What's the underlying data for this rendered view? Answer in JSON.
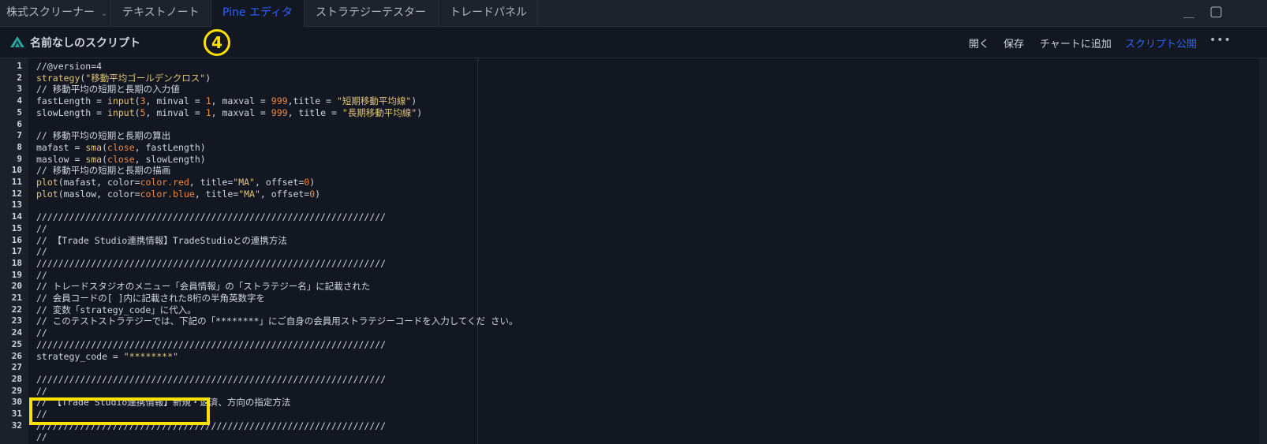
{
  "tabs": [
    {
      "label": "株式スクリーナー",
      "has_chevron": true
    },
    {
      "label": "テキストノート"
    },
    {
      "label": "Pine エディタ",
      "active": true
    },
    {
      "label": "ストラテジーテスター"
    },
    {
      "label": "トレードパネル"
    }
  ],
  "window": {
    "minimize": "＿",
    "maximize": "▢"
  },
  "toolbar": {
    "title": "名前なしのスクリプト",
    "badge": "4",
    "open": "開く",
    "save": "保存",
    "add_to_chart": "チャートに追加",
    "publish": "スクリプト公開",
    "more": "•••"
  },
  "colors": {
    "accent": "#2962ff",
    "highlight": "#ffe100",
    "background": "#131722"
  },
  "code_lines": [
    "//@version=4",
    "strategy(\"移動平均ゴールデンクロス\")",
    "// 移動平均の短期と長期の入力値",
    "fastLength = input(3, minval = 1, maxval = 999,title = \"短期移動平均線\")",
    "slowLength = input(5, minval = 1, maxval = 999, title = \"長期移動平均線\")",
    "",
    "// 移動平均の短期と長期の算出",
    "mafast = sma(close, fastLength)",
    "maslow = sma(close, slowLength)",
    "// 移動平均の短期と長期の描画",
    "plot(mafast, color=color.red, title=\"MA\", offset=0)",
    "plot(maslow, color=color.blue, title=\"MA\", offset=0)",
    "",
    "////////////////////////////////////////////////////////////////",
    "//",
    "// 【Trade Studio連携情報】TradeStudioとの連携方法",
    "//",
    "////////////////////////////////////////////////////////////////",
    "//",
    "// トレードスタジオのメニュー「会員情報」の「ストラテジー名」に記載された",
    "// 会員コードの[ ]内に記載された8桁の半角英数字を",
    "// 変数「strategy_code」に代入。",
    "// このテストストラテジーでは、下記の「********」にご自身の会員用ストラテジーコードを入力してくだ さい。",
    "//",
    "////////////////////////////////////////////////////////////////",
    "strategy_code = \"********\"",
    "",
    "////////////////////////////////////////////////////////////////",
    "//",
    "// 【Trade Studio連携情報】新規・返済、方向の指定方法",
    "//",
    "////////////////////////////////////////////////////////////////",
    "//"
  ],
  "line_numbers": [
    "1",
    "2",
    "3",
    "4",
    "5",
    "6",
    "7",
    "8",
    "9",
    "10",
    "11",
    "12",
    "13",
    "14",
    "15",
    "16",
    "17",
    "18",
    "19",
    "20",
    "21",
    "22",
    "23",
    "24",
    "25",
    "26",
    "27",
    "28",
    "29",
    "30",
    "31",
    "32",
    ""
  ]
}
